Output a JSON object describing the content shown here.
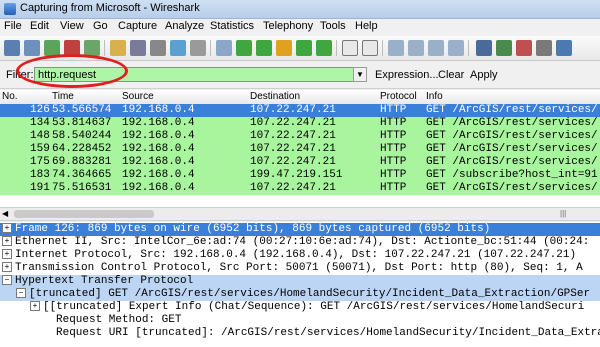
{
  "window": {
    "title": "Capturing from Microsoft - Wireshark"
  },
  "menu": {
    "items": [
      "File",
      "Edit",
      "View",
      "Go",
      "Capture",
      "Analyze",
      "Statistics",
      "Telephony",
      "Tools",
      "Help"
    ],
    "underlines": [
      "F",
      "E",
      "V",
      "G",
      "C",
      "A",
      "S",
      "",
      "T",
      "H"
    ]
  },
  "toolbar": {
    "icons": [
      "interface-list-icon",
      "capture-options-icon",
      "start-capture-icon",
      "stop-capture-icon",
      "restart-capture-icon",
      "open-icon",
      "save-icon",
      "close-file-icon",
      "reload-icon",
      "print-icon",
      "find-icon",
      "back-icon",
      "forward-icon",
      "go-to-packet-icon",
      "first-packet-icon",
      "last-packet-icon",
      "packet-list-icon",
      "autoscroll-icon",
      "colorize-icon",
      "zoom-in-icon",
      "zoom-out-icon",
      "normal-size-icon",
      "resize-columns-icon",
      "capture-filters-icon",
      "display-filters-icon",
      "coloring-rules-icon",
      "preferences-icon",
      "help-icon"
    ]
  },
  "filter": {
    "label": "Filter:",
    "value": "http.request",
    "expression_label": "Expression...",
    "clear_label": "Clear",
    "apply_label": "Apply"
  },
  "packet_list": {
    "columns": [
      "No.",
      "Time",
      "Source",
      "Destination",
      "Protocol",
      "Info"
    ],
    "rows": [
      {
        "no": "126",
        "time": "53.566574",
        "source": "192.168.0.4",
        "destination": "107.22.247.21",
        "protocol": "HTTP",
        "info": "GET /ArcGIS/rest/services/",
        "selected": true
      },
      {
        "no": "134",
        "time": "53.814637",
        "source": "192.168.0.4",
        "destination": "107.22.247.21",
        "protocol": "HTTP",
        "info": "GET /ArcGIS/rest/services/",
        "selected": false
      },
      {
        "no": "148",
        "time": "58.540244",
        "source": "192.168.0.4",
        "destination": "107.22.247.21",
        "protocol": "HTTP",
        "info": "GET /ArcGIS/rest/services/",
        "selected": false
      },
      {
        "no": "159",
        "time": "64.228452",
        "source": "192.168.0.4",
        "destination": "107.22.247.21",
        "protocol": "HTTP",
        "info": "GET /ArcGIS/rest/services/",
        "selected": false
      },
      {
        "no": "175",
        "time": "69.883281",
        "source": "192.168.0.4",
        "destination": "107.22.247.21",
        "protocol": "HTTP",
        "info": "GET /ArcGIS/rest/services/",
        "selected": false
      },
      {
        "no": "183",
        "time": "74.364665",
        "source": "192.168.0.4",
        "destination": "199.47.219.151",
        "protocol": "HTTP",
        "info": "GET /subscribe?host_int=91",
        "selected": false
      },
      {
        "no": "191",
        "time": "75.516531",
        "source": "192.168.0.4",
        "destination": "107.22.247.21",
        "protocol": "HTTP",
        "info": "GET /ArcGIS/rest/services/",
        "selected": false
      }
    ]
  },
  "details": {
    "lines": [
      {
        "text": "Frame 126: 869 bytes on wire (6952 bits), 869 bytes captured (6952 bits)",
        "expander": "+",
        "indent": 0,
        "style": "hl"
      },
      {
        "text": "Ethernet II, Src: IntelCor_6e:ad:74 (00:27:10:6e:ad:74), Dst: Actionte_bc:51:44 (00:24:",
        "expander": "+",
        "indent": 0,
        "style": ""
      },
      {
        "text": "Internet Protocol, Src: 192.168.0.4 (192.168.0.4), Dst: 107.22.247.21 (107.22.247.21)",
        "expander": "+",
        "indent": 0,
        "style": ""
      },
      {
        "text": "Transmission Control Protocol, Src Port: 50071 (50071), Dst Port: http (80), Seq: 1, A",
        "expander": "+",
        "indent": 0,
        "style": ""
      },
      {
        "text": "Hypertext Transfer Protocol",
        "expander": "-",
        "indent": 0,
        "style": "sub"
      },
      {
        "text": "[truncated] GET /ArcGIS/rest/services/HomelandSecurity/Incident_Data_Extraction/GPSer",
        "expander": "-",
        "indent": 1,
        "style": "sub"
      },
      {
        "text": "[[truncated] Expert Info (Chat/Sequence): GET /ArcGIS/rest/services/HomelandSecuri",
        "expander": "+",
        "indent": 2,
        "style": ""
      },
      {
        "text": "Request Method: GET",
        "expander": "",
        "indent": 3,
        "style": ""
      },
      {
        "text": "Request URI [truncated]: /ArcGIS/rest/services/HomelandSecurity/Incident_Data_Extra",
        "expander": "",
        "indent": 3,
        "style": ""
      }
    ]
  },
  "colors": {
    "http_row": "#a7f59c",
    "selected_row": "#3a7fd9",
    "filter_ok": "#aff5a8",
    "annotation": "#e0201f"
  }
}
